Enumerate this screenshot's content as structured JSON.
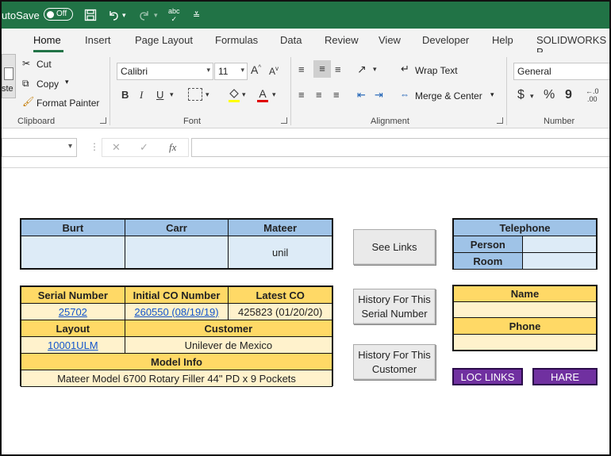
{
  "titlebar": {
    "autosave_label": "utoSave",
    "autosave_state": "Off",
    "icons": [
      "save-icon",
      "undo-icon",
      "redo-icon",
      "spelling-icon",
      "customize-qat-icon"
    ],
    "spelling_label": "abc"
  },
  "tabs": [
    "Home",
    "Insert",
    "Page Layout",
    "Formulas",
    "Data",
    "Review",
    "View",
    "Developer",
    "Help",
    "SOLIDWORKS P"
  ],
  "active_tab": "Home",
  "ribbon": {
    "clipboard": {
      "paste": "ste",
      "cut": "Cut",
      "copy": "Copy",
      "format_painter": "Format Painter",
      "label": "Clipboard"
    },
    "font": {
      "name": "Calibri",
      "size": "11",
      "grow": "A",
      "shrink": "A",
      "bold": "B",
      "italic": "I",
      "underline": "U",
      "font_color_letter": "A",
      "label": "Font"
    },
    "alignment": {
      "wrap_text": "Wrap Text",
      "merge_center": "Merge & Center",
      "label": "Alignment"
    },
    "number": {
      "format": "General",
      "currency": "$",
      "percent": "%",
      "comma": "9",
      "label": "Number"
    }
  },
  "formula_bar": {
    "fx": "fx",
    "cancel": "✕",
    "enter": "✓"
  },
  "people_table": {
    "headers": [
      "Burt",
      "Carr",
      "Mateer"
    ],
    "values": [
      "",
      "",
      "unil"
    ]
  },
  "telephone_table": {
    "header": "Telephone",
    "rows": [
      {
        "label": "Person",
        "value": ""
      },
      {
        "label": "Room",
        "value": ""
      }
    ]
  },
  "machine_table": {
    "serial_header": "Serial Number",
    "initial_co_header": "Initial CO Number",
    "latest_co_header": "Latest CO",
    "serial": "25702",
    "initial_co": "260550 (08/19/19)",
    "latest_co": "425823 (01/20/20)",
    "layout_header": "Layout",
    "customer_header": "Customer",
    "layout": "10001ULM",
    "customer": "Unilever de Mexico",
    "model_header": "Model Info",
    "model": "Mateer Model 6700 Rotary Filler 44\" PD x 9 Pockets"
  },
  "contact_table": {
    "name_header": "Name",
    "name_value": "",
    "phone_header": "Phone",
    "phone_value": ""
  },
  "buttons": {
    "see_links": "See Links",
    "history_serial": "History For This\nSerial Number",
    "history_customer": "History For This\nCustomer",
    "loc_links": "LOC LINKS",
    "hare": "HARE"
  },
  "colors": {
    "excel_green": "#217346",
    "header_blue": "#9fc3e7",
    "cell_blue": "#ddebf7",
    "header_gold": "#ffd966",
    "cell_cream": "#fff2cc",
    "purple": "#7030a0"
  }
}
